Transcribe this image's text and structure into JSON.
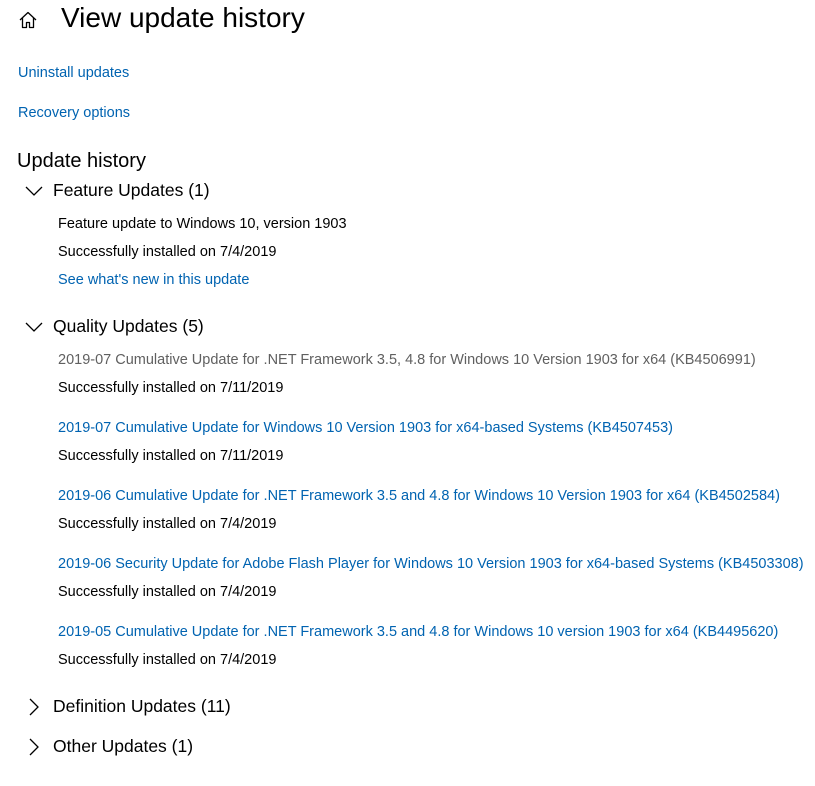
{
  "header": {
    "home_icon": "home-icon",
    "title": "View update history"
  },
  "links": {
    "uninstall": "Uninstall updates",
    "recovery": "Recovery options"
  },
  "history": {
    "title": "Update history",
    "groups": [
      {
        "label": "Feature Updates (1)",
        "expanded": true,
        "items": [
          {
            "title": "Feature update to Windows 10, version 1903",
            "status": "Successfully installed on 7/4/2019",
            "link": "See what's new in this update"
          }
        ]
      },
      {
        "label": "Quality Updates (5)",
        "expanded": true,
        "items": [
          {
            "title": "2019-07 Cumulative Update for .NET Framework 3.5, 4.8 for Windows 10 Version 1903 for x64 (KB4506991)",
            "status": "Successfully installed on 7/11/2019",
            "is_link": false
          },
          {
            "title": "2019-07 Cumulative Update for Windows 10 Version 1903 for x64-based Systems (KB4507453)",
            "status": "Successfully installed on 7/11/2019",
            "is_link": true
          },
          {
            "title": "2019-06 Cumulative Update for .NET Framework 3.5 and 4.8 for Windows 10 Version 1903 for x64 (KB4502584)",
            "status": "Successfully installed on 7/4/2019",
            "is_link": true
          },
          {
            "title": "2019-06 Security Update for Adobe Flash Player for Windows 10 Version 1903 for x64-based Systems (KB4503308)",
            "status": "Successfully installed on 7/4/2019",
            "is_link": true
          },
          {
            "title": "2019-05 Cumulative Update for .NET Framework 3.5 and 4.8 for Windows 10 version 1903 for x64 (KB4495620)",
            "status": "Successfully installed on 7/4/2019",
            "is_link": true
          }
        ]
      },
      {
        "label": "Definition Updates (11)",
        "expanded": false,
        "items": []
      },
      {
        "label": "Other Updates (1)",
        "expanded": false,
        "items": []
      }
    ]
  },
  "colors": {
    "link": "#0063b1",
    "text": "#000000",
    "muted": "#606060"
  }
}
